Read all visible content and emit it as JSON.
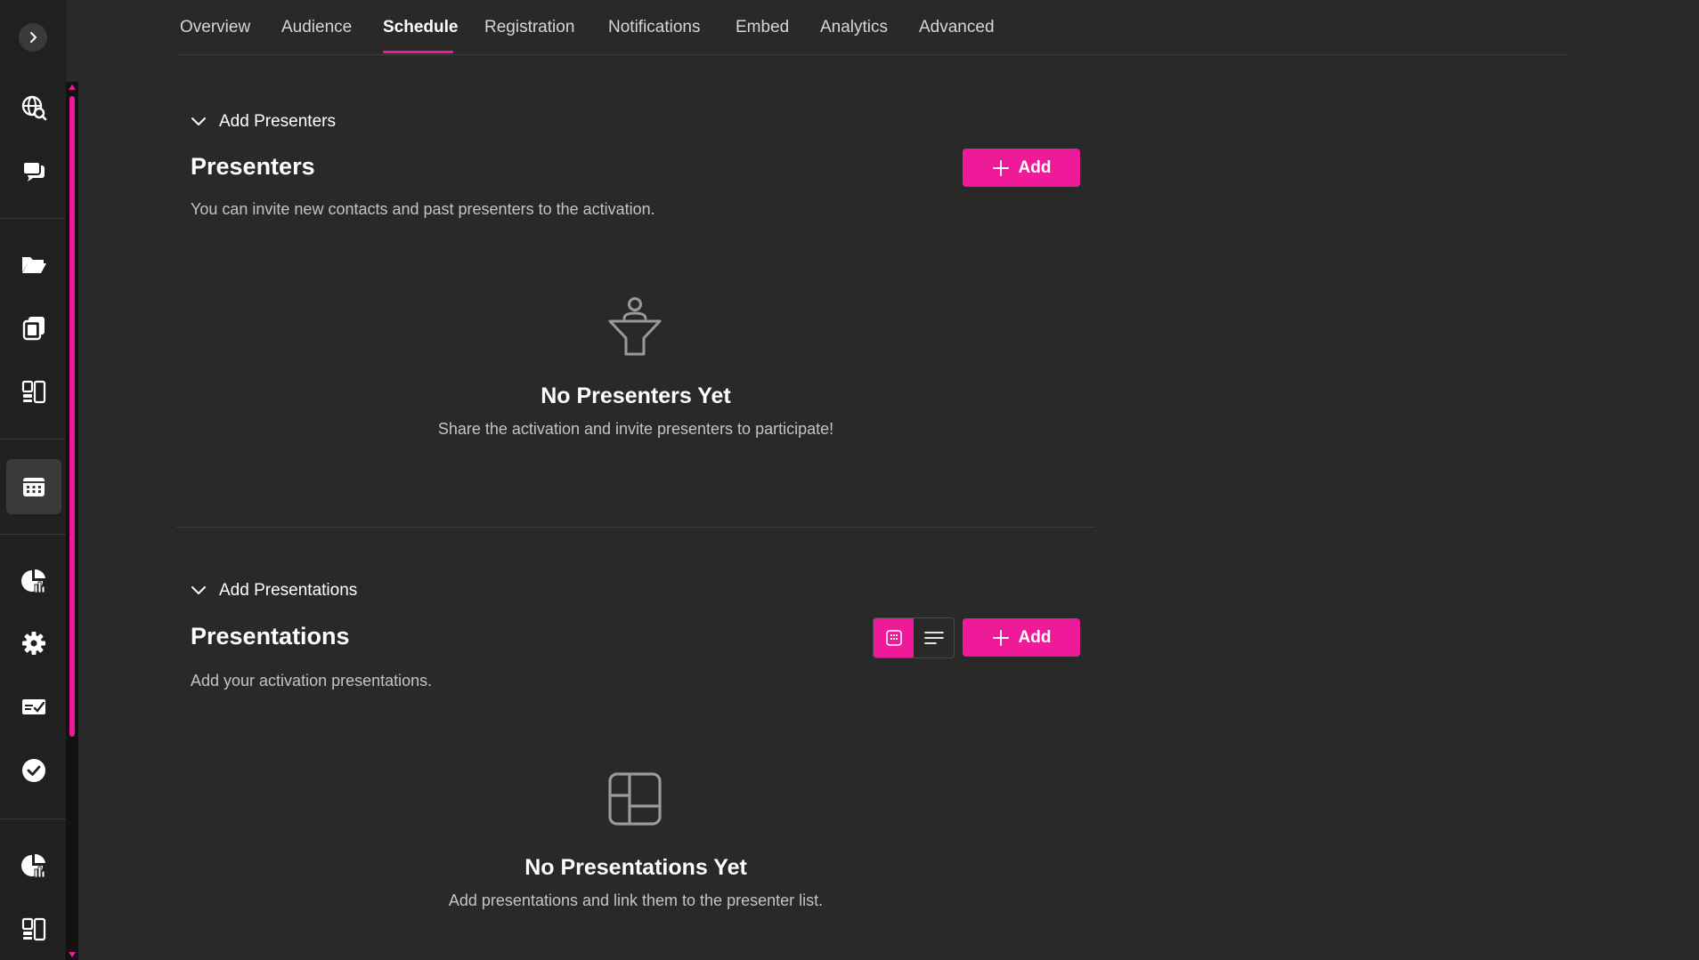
{
  "tabs": [
    {
      "label": "Overview"
    },
    {
      "label": "Audience"
    },
    {
      "label": "Schedule",
      "active": true
    },
    {
      "label": "Registration"
    },
    {
      "label": "Notifications"
    },
    {
      "label": "Embed"
    },
    {
      "label": "Analytics"
    },
    {
      "label": "Advanced"
    }
  ],
  "sidebar": {
    "icons": [
      "globe-search-icon",
      "chat-stack-icon",
      "folder-open-icon",
      "copy-pages-icon",
      "layout-devices-icon",
      "calendar-icon",
      "pie-chart-analytics-icon",
      "gear-icon",
      "ticket-check-icon",
      "check-circle-icon",
      "pie-chart-icon",
      "layout-icon"
    ],
    "active": "calendar-icon"
  },
  "presenters": {
    "toggle_label": "Add Presenters",
    "title": "Presenters",
    "description": "You can invite new contacts and past presenters to the activation.",
    "add_label": "Add",
    "empty_title": "No Presenters Yet",
    "empty_desc": "Share the activation and invite presenters to participate!"
  },
  "presentations": {
    "toggle_label": "Add Presentations",
    "title": "Presentations",
    "description": "Add your activation presentations.",
    "add_label": "Add",
    "empty_title": "No Presentations Yet",
    "empty_desc": "Add presentations and link them to the presenter list.",
    "view_mode": "grid"
  },
  "colors": {
    "accent": "#ef1a9a",
    "background": "#292929",
    "rail": "#202020"
  }
}
